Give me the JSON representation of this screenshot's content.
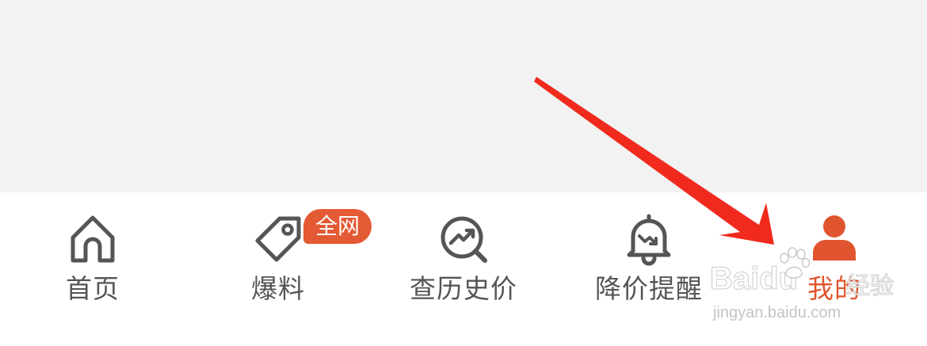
{
  "tabbar": {
    "items": [
      {
        "label": "首页",
        "icon": "home-icon"
      },
      {
        "label": "爆料",
        "icon": "tag-icon",
        "badge": "全网"
      },
      {
        "label": "查历史价",
        "icon": "price-history-icon"
      },
      {
        "label": "降价提醒",
        "icon": "bell-price-drop-icon"
      },
      {
        "label": "我的",
        "icon": "user-icon",
        "active": true
      }
    ]
  },
  "watermark": {
    "brand": "Baidu",
    "suffix": "经验",
    "url": "jingyan.baidu.com"
  },
  "colors": {
    "accent": "#e0552f",
    "arrow": "#f02a1c",
    "icon_gray": "#555555",
    "top_background": "#f2f2f2"
  }
}
